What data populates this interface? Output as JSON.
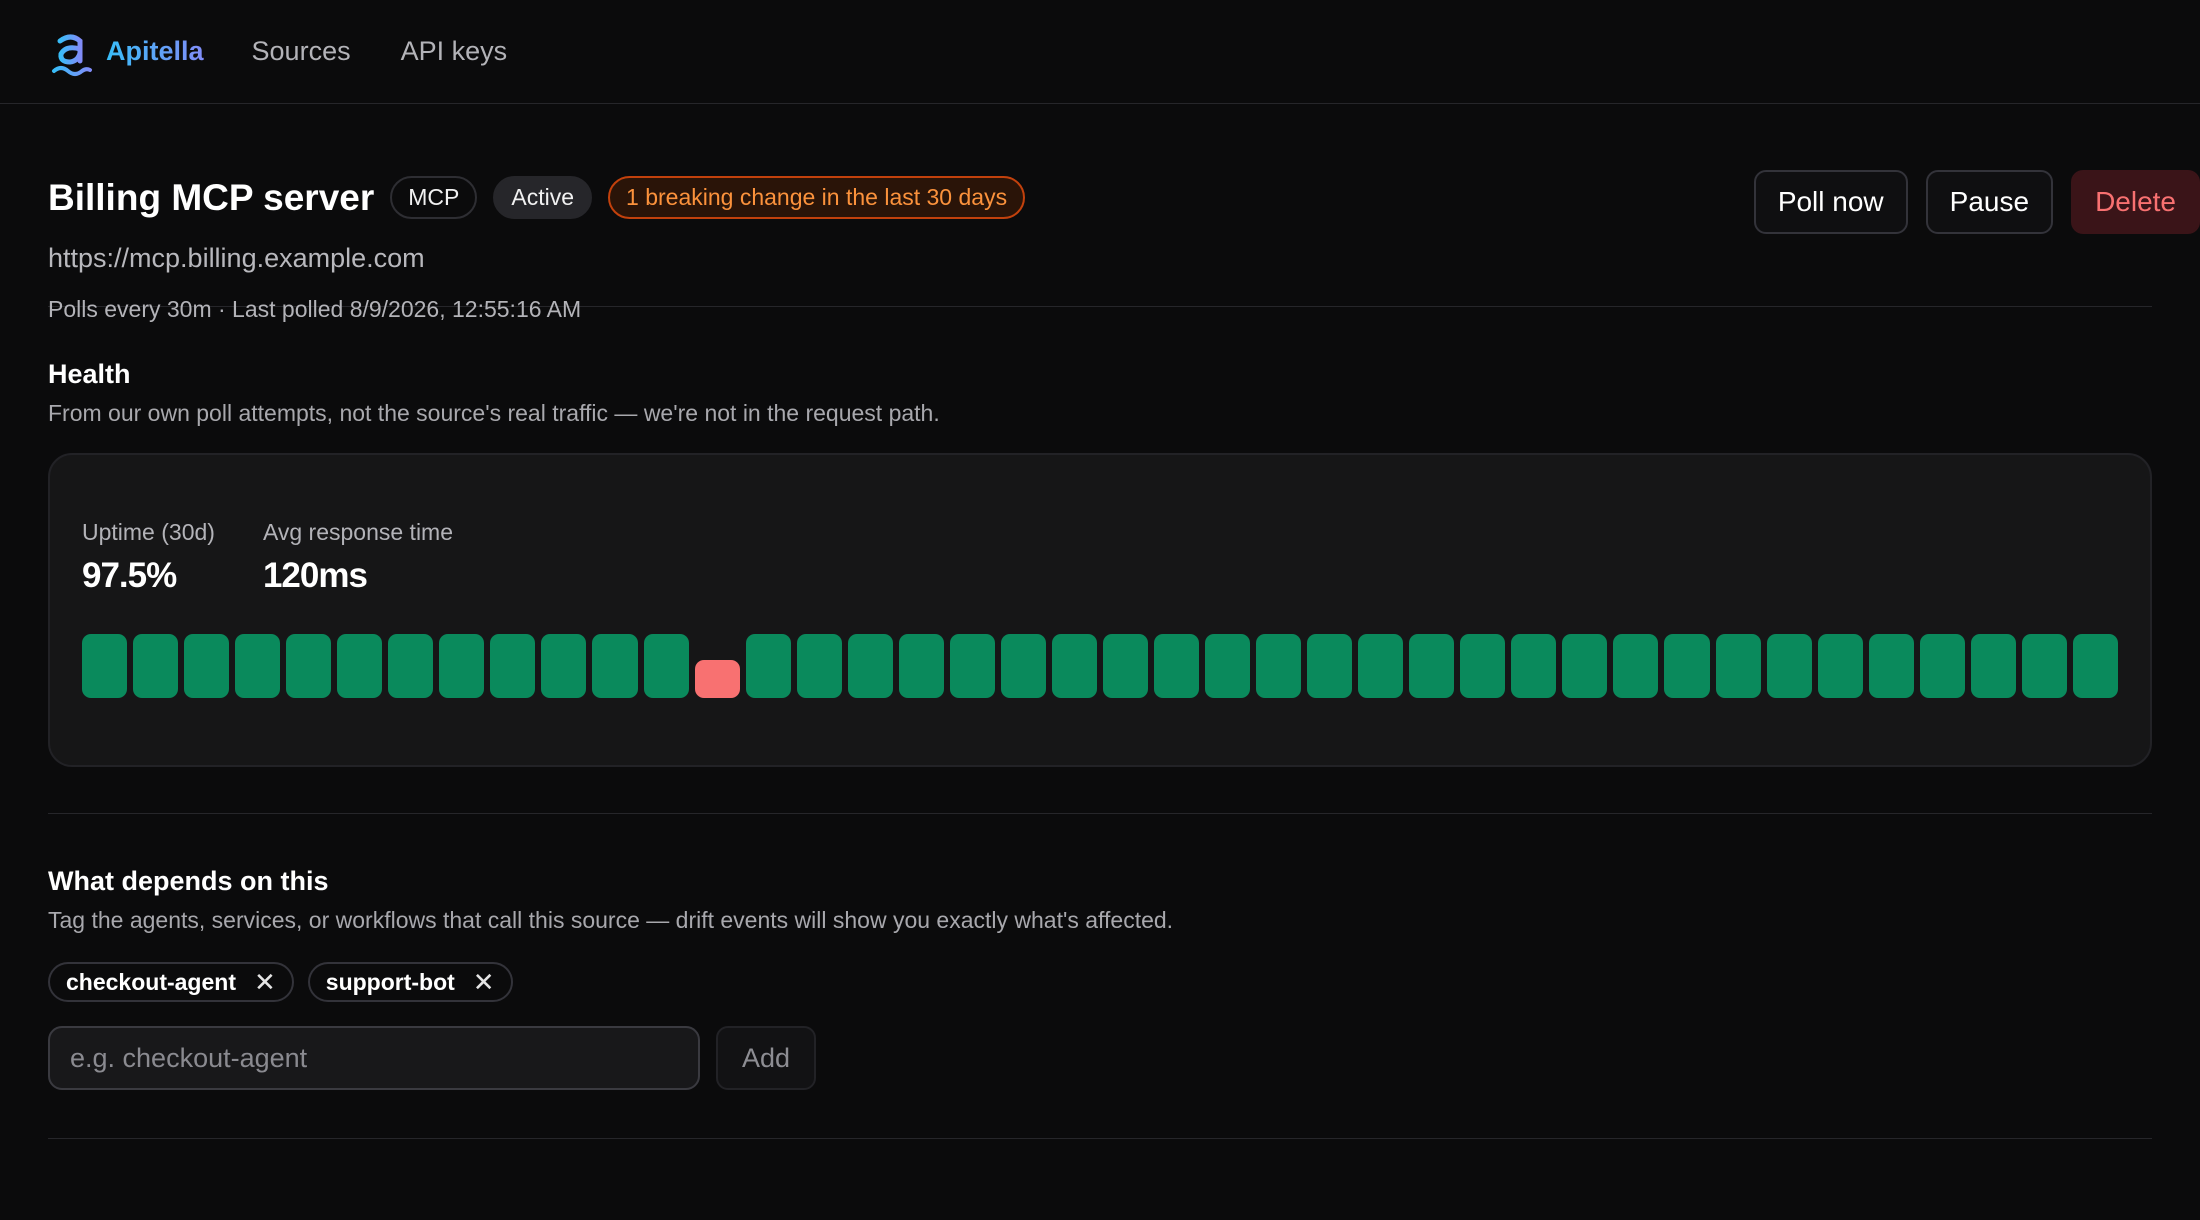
{
  "brand": {
    "name": "Apitella",
    "logo_icon": "apitella-logo-icon"
  },
  "nav": {
    "items": [
      {
        "label": "Sources"
      },
      {
        "label": "API keys"
      }
    ]
  },
  "source": {
    "title": "Billing MCP server",
    "type_badge": "MCP",
    "status_badge": "Active",
    "alert_badge": "1 breaking change in the last 30 days",
    "url": "https://mcp.billing.example.com",
    "meta": "Polls every 30m · Last polled 8/9/2026, 12:55:16 AM"
  },
  "actions": {
    "poll_now": "Poll now",
    "pause": "Pause",
    "delete": "Delete"
  },
  "health": {
    "title": "Health",
    "subtitle": "From our own poll attempts, not the source's real traffic — we're not in the request path.",
    "uptime_label": "Uptime (30d)",
    "uptime_value": "97.5%",
    "avg_label": "Avg response time",
    "avg_value": "120ms",
    "status_colors": {
      "up": "#0a8a5c",
      "down": "#f87171"
    },
    "days": [
      "up",
      "up",
      "up",
      "up",
      "up",
      "up",
      "up",
      "up",
      "up",
      "up",
      "up",
      "up",
      "down",
      "up",
      "up",
      "up",
      "up",
      "up",
      "up",
      "up",
      "up",
      "up",
      "up",
      "up",
      "up",
      "up",
      "up",
      "up",
      "up",
      "up",
      "up",
      "up",
      "up",
      "up",
      "up",
      "up",
      "up",
      "up",
      "up",
      "up"
    ]
  },
  "dependents": {
    "title": "What depends on this",
    "subtitle": "Tag the agents, services, or workflows that call this source — drift events will show you exactly what's affected.",
    "tags": [
      {
        "label": "checkout-agent"
      },
      {
        "label": "support-bot"
      }
    ],
    "remove_glyph": "✕",
    "input_placeholder": "e.g. checkout-agent",
    "add_label": "Add"
  }
}
